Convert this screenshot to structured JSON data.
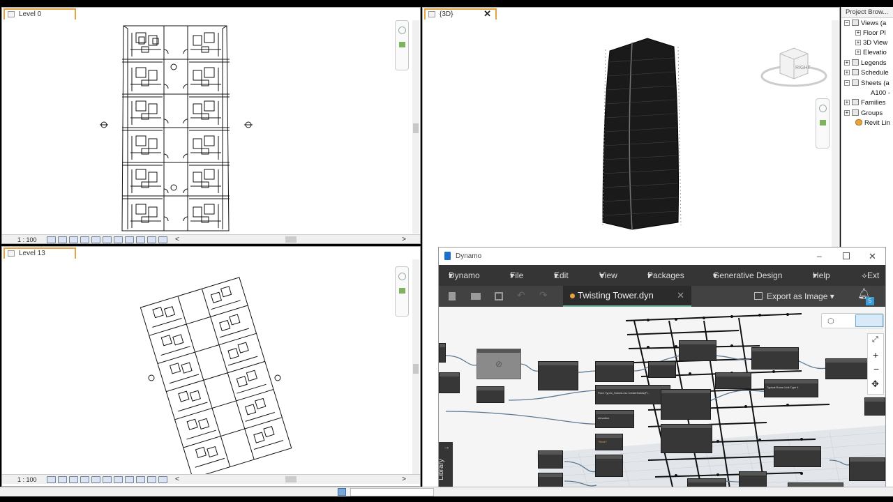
{
  "views": {
    "level0": {
      "tab": "Level 0",
      "scale": "1 : 100"
    },
    "view3d": {
      "tab": "{3D}",
      "cube_label": "RIGHT"
    },
    "level13": {
      "tab": "Level 13",
      "scale": "1 : 100"
    },
    "scroll_left": "<",
    "scroll_right": ">",
    "close_glyph": "✕"
  },
  "project_browser": {
    "title": "Project Brow...",
    "items": [
      {
        "label": "Views (a",
        "icon": "view-icon"
      },
      {
        "label": "Floor Pl",
        "icon": "folder-icon"
      },
      {
        "label": "3D View",
        "icon": "folder-icon"
      },
      {
        "label": "Elevatio",
        "icon": "folder-icon"
      },
      {
        "label": "Legends",
        "icon": "legend-icon"
      },
      {
        "label": "Schedule",
        "icon": "schedule-icon"
      },
      {
        "label": "Sheets (a",
        "icon": "sheet-icon"
      },
      {
        "label": "A100 - ",
        "icon": ""
      },
      {
        "label": "Families",
        "icon": "family-icon"
      },
      {
        "label": "Groups",
        "icon": "group-icon"
      },
      {
        "label": "Revit Lin",
        "icon": "link-icon"
      }
    ]
  },
  "dynamo": {
    "window_title": "Dynamo",
    "menu": [
      "Dynamo",
      "File",
      "Edit",
      "View",
      "Packages",
      "Generative Design",
      "Help",
      "Ext"
    ],
    "file_tab": "Twisting Tower.dyn",
    "export": "Export as Image",
    "notification_count": "5",
    "library": "Library",
    "node_labels": {
      "n1": "Floor Types_Solved.csv  CreateSolids(Fl...",
      "n2": "Typical Room Unit Type 4",
      "n3": "Typical Room Unit Type 4",
      "n4": "elevation",
      "n5": "\"Stoch\""
    }
  },
  "colors": {
    "accent": "#e6a341",
    "dynamo_dark": "#353535",
    "notify": "#3a9bd8"
  }
}
